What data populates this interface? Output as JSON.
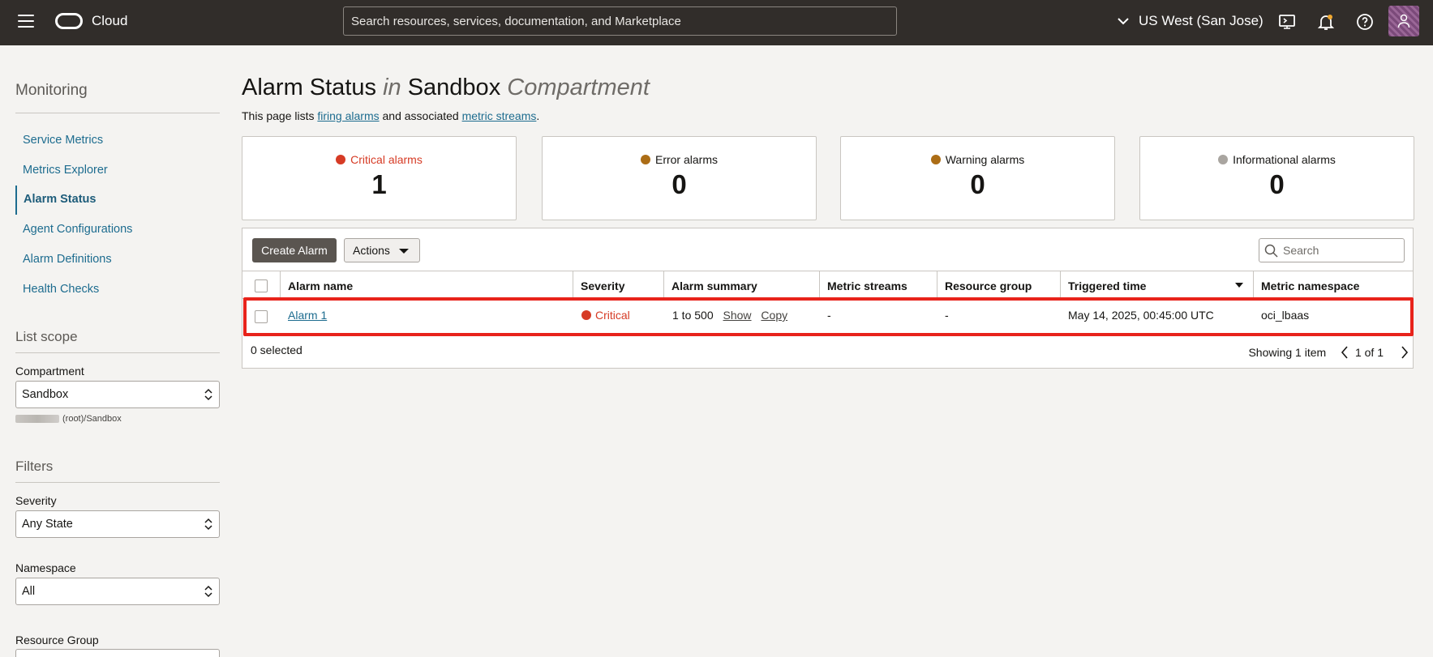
{
  "topbar": {
    "logo_text": "Cloud",
    "search_placeholder": "Search resources, services, documentation, and Marketplace",
    "region": "US West (San Jose)"
  },
  "sidebar": {
    "section_title": "Monitoring",
    "items": [
      {
        "label": "Service Metrics"
      },
      {
        "label": "Metrics Explorer"
      },
      {
        "label": "Alarm Status"
      },
      {
        "label": "Agent Configurations"
      },
      {
        "label": "Alarm Definitions"
      },
      {
        "label": "Health Checks"
      }
    ],
    "list_scope": {
      "title": "List scope",
      "compartment_label": "Compartment",
      "compartment_value": "Sandbox",
      "compartment_path": "(root)/Sandbox"
    },
    "filters": {
      "title": "Filters",
      "severity_label": "Severity",
      "severity_value": "Any State",
      "namespace_label": "Namespace",
      "namespace_value": "All",
      "resource_group_label": "Resource Group"
    }
  },
  "page": {
    "title_main": "Alarm Status",
    "title_in": "in",
    "title_compartment": "Sandbox",
    "title_suffix": "Compartment",
    "subtitle_pre": "This page lists ",
    "subtitle_link1": "firing alarms",
    "subtitle_mid": " and associated ",
    "subtitle_link2": "metric streams",
    "subtitle_end": "."
  },
  "cards": [
    {
      "label": "Critical alarms",
      "count": "1",
      "color": "#d63b25"
    },
    {
      "label": "Error alarms",
      "count": "0",
      "color": "#ac6d16"
    },
    {
      "label": "Warning alarms",
      "count": "0",
      "color": "#ac6d16"
    },
    {
      "label": "Informational alarms",
      "count": "0",
      "color": "#a9a5a0"
    }
  ],
  "toolbar": {
    "create_label": "Create Alarm",
    "actions_label": "Actions",
    "search_placeholder": "Search"
  },
  "table": {
    "columns": [
      "Alarm name",
      "Severity",
      "Alarm summary",
      "Metric streams",
      "Resource group",
      "Triggered time",
      "Metric namespace"
    ],
    "rows": [
      {
        "name": "Alarm 1",
        "severity": "Critical",
        "summary": "1 to 500",
        "show": "Show",
        "copy": "Copy",
        "metric_streams": "-",
        "resource_group": "-",
        "triggered": "May 14, 2025, 00:45:00 UTC",
        "namespace": "oci_lbaas"
      }
    ],
    "selected_text": "0 selected",
    "showing_text": "Showing 1 item",
    "page_text": "1 of 1"
  }
}
